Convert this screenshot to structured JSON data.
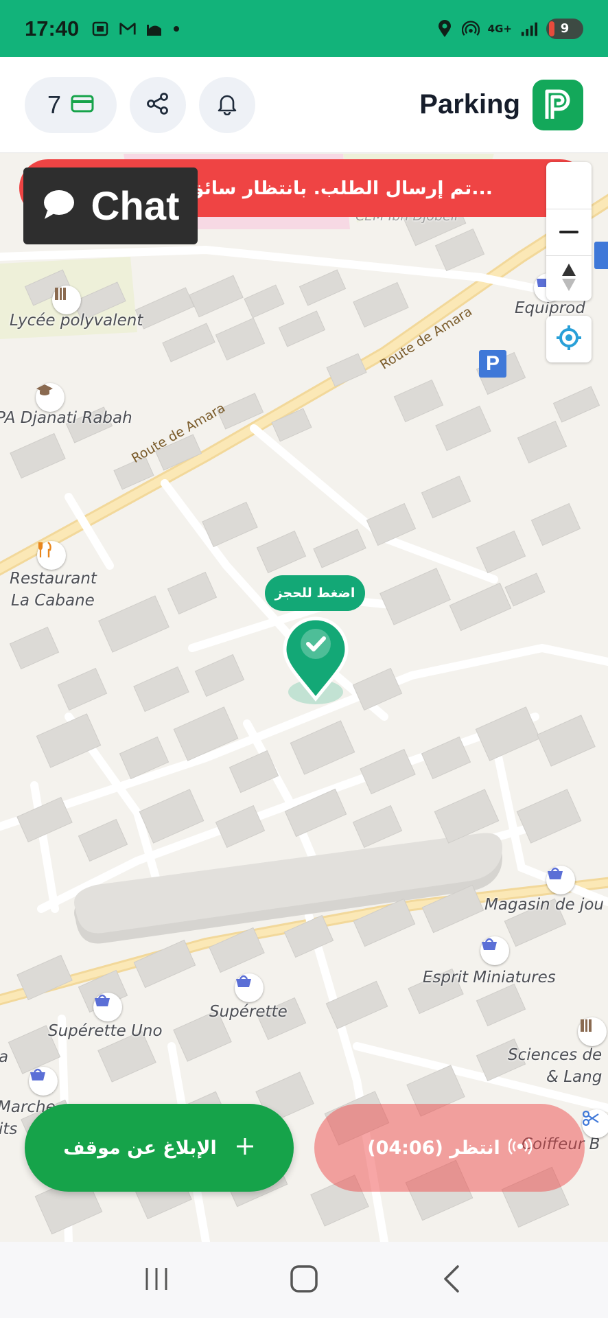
{
  "status_bar": {
    "time": "17:40",
    "network_label": "4G+",
    "battery_level": "9",
    "icons": [
      "screenshot-icon",
      "gmail-icon",
      "mosque-icon",
      "dot-icon",
      "location-icon",
      "hotspot-icon",
      "signal-icon",
      "battery-icon"
    ]
  },
  "header": {
    "credits_count": "7",
    "credits_icon": "card-icon",
    "share_icon": "share-icon",
    "notifications_icon": "bell-icon",
    "app_title": "Parking",
    "logo_icon": "parking-logo-icon",
    "accent_color": "#13a85a"
  },
  "alert": {
    "text": "تم إرسال الطلب. بانتظار سائق...",
    "icon": "siren-icon",
    "color": "#ef4444"
  },
  "chat": {
    "label": "Chat",
    "icon": "chat-bubble-icon"
  },
  "map": {
    "places": {
      "lycee": "Lycée polyvalent",
      "djanati": "PA Djanati Rabah",
      "restaurant_1": "Restaurant",
      "restaurant_2": "La Cabane",
      "equiprod": "Equiprod",
      "magasin": "Magasin de jou",
      "esprit": "Esprit Miniatures",
      "superette": "Supérette",
      "superette_uno": "Supérette Uno",
      "sciences_1": "Sciences de",
      "sciences_2": "& Lang",
      "marche": "Marche",
      "its": "its",
      "a_left": "a",
      "coiffeur": "Coiffeur B",
      "cem": "CEM Ibn Djobeir"
    },
    "roads": {
      "route_amara_1": "Route de Amara",
      "route_amara_2": "Route de Amara"
    },
    "parking_sign": "P",
    "controls": {
      "zoom_out_icon": "minus-icon",
      "compass_icon": "compass-icon",
      "locate_icon": "locate-icon"
    }
  },
  "pin": {
    "tooltip": "اضغط للحجز",
    "icon": "check-pin-icon",
    "color": "#13a876"
  },
  "actions": {
    "report_label": "الإبلاغ عن موقف",
    "report_icon": "plus-icon",
    "wait_label": "انتظر (04:06)",
    "wait_icon": "broadcast-icon"
  },
  "nav": {
    "recents_icon": "recents-icon",
    "home_icon": "home-icon",
    "back_icon": "back-icon"
  }
}
